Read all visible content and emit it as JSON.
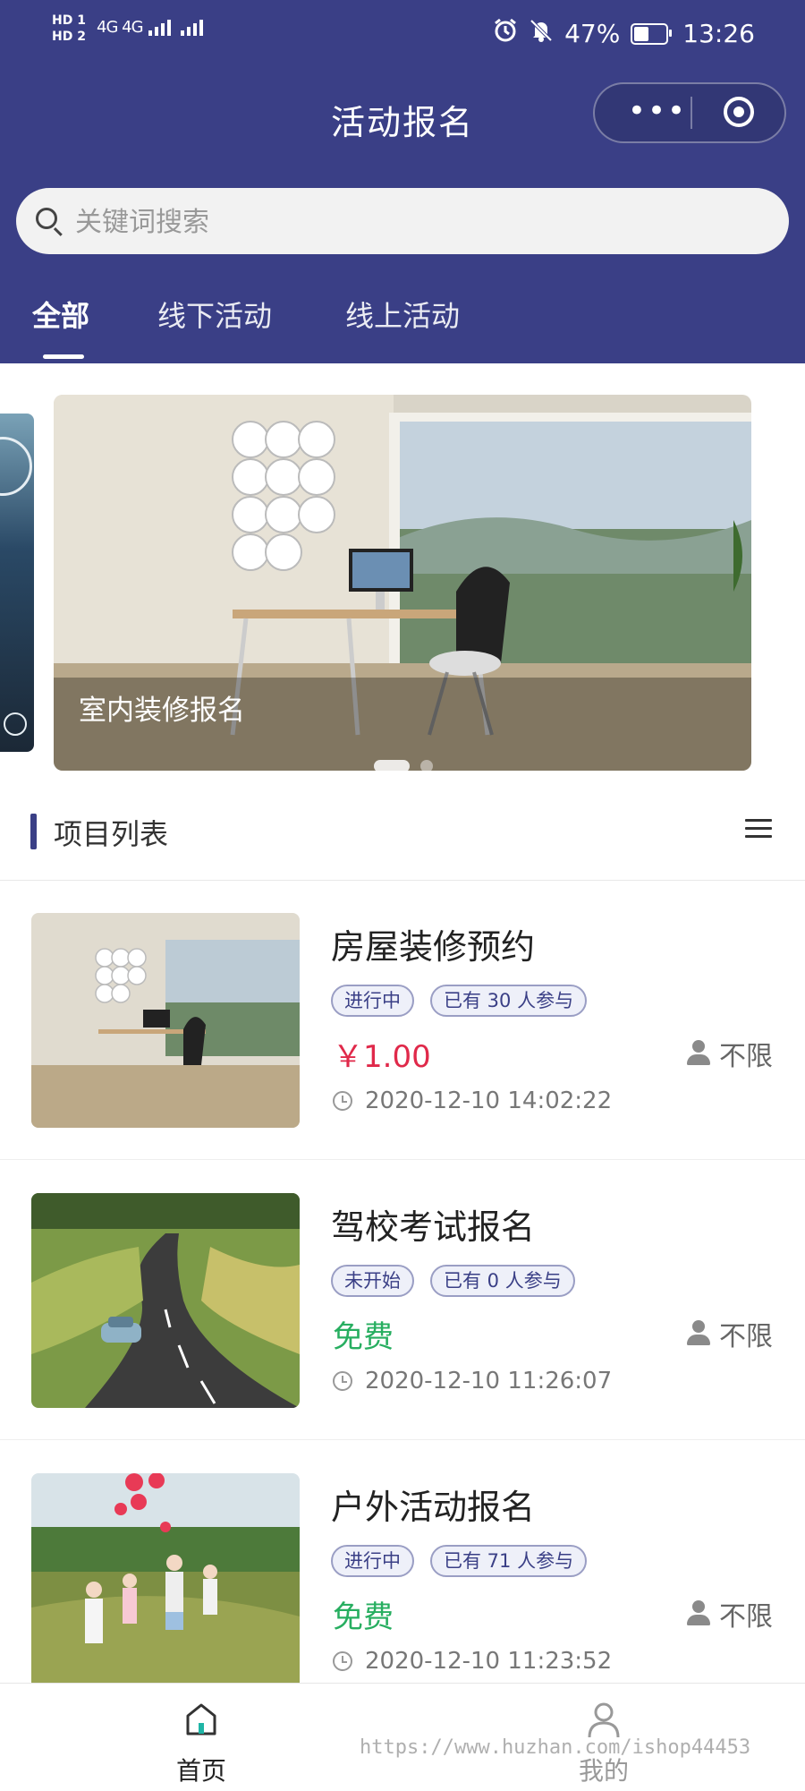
{
  "status_bar": {
    "hd_line1": "HD 1",
    "hd_line2": "HD 2",
    "network": "4G 4G",
    "battery": "47%",
    "battery_level": 0.47,
    "time": "13:26"
  },
  "nav": {
    "title": "活动报名",
    "more_glyph": "•••",
    "icons": [
      "more-icon",
      "target-icon",
      "alarm-icon",
      "mute-icon",
      "battery-icon"
    ]
  },
  "search": {
    "placeholder": "关键词搜索"
  },
  "tabs": [
    {
      "label": "全部",
      "active": true
    },
    {
      "label": "线下活动",
      "active": false
    },
    {
      "label": "线上活动",
      "active": false
    }
  ],
  "banner": {
    "caption": "室内装修报名",
    "slide_count": 2,
    "active_slide": 1
  },
  "section": {
    "title": "项目列表"
  },
  "items": [
    {
      "name": "房屋装修预约",
      "status": "进行中",
      "participants": "已有 30 人参与",
      "price": "￥1.00",
      "price_color": "#e0294a",
      "limit": "不限",
      "time": "2020-12-10 14:02:22"
    },
    {
      "name": "驾校考试报名",
      "status": "未开始",
      "participants": "已有 0 人参与",
      "price": "免费",
      "price_color": "#27ae60",
      "limit": "不限",
      "time": "2020-12-10 11:26:07"
    },
    {
      "name": "户外活动报名",
      "status": "进行中",
      "participants": "已有 71 人参与",
      "price": "免费",
      "price_color": "#27ae60",
      "limit": "不限",
      "time": "2020-12-10 11:23:52"
    }
  ],
  "tabbar": [
    {
      "label": "首页",
      "icon": "home-icon",
      "active": true
    },
    {
      "label": "我的",
      "icon": "user-icon",
      "active": false
    }
  ],
  "watermark": "https://www.huzhan.com/ishop44453",
  "colors": {
    "header_bg": "#3a3f86",
    "accent": "#3a3f86",
    "price_red": "#e0294a",
    "free_green": "#27ae60",
    "home_active": "#1fb5a6"
  }
}
